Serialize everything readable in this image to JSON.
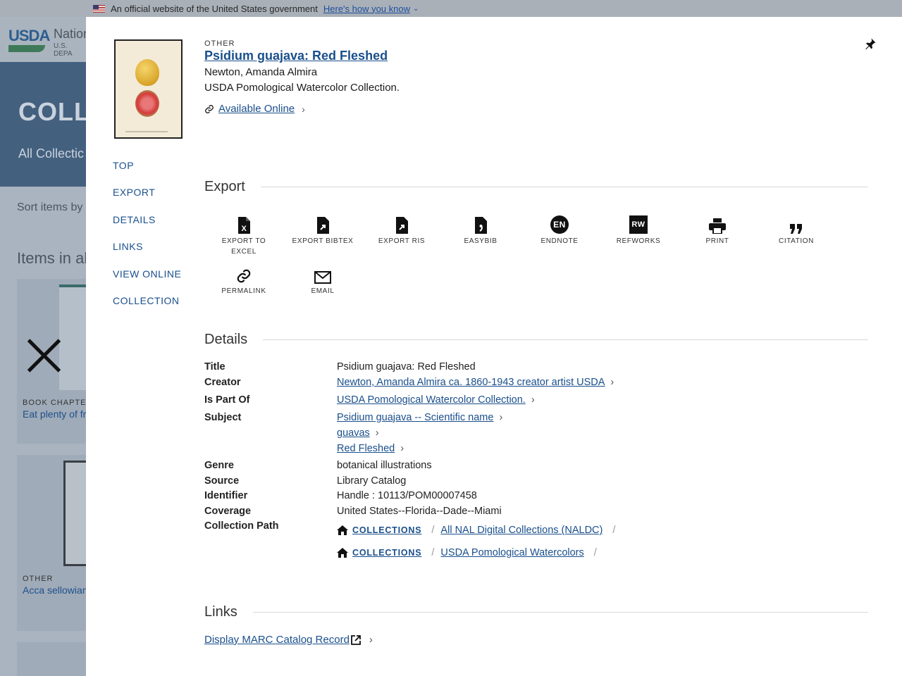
{
  "banner": {
    "text": "An official website of the United States government",
    "link": "Here's how you know"
  },
  "background": {
    "logo": "USDA",
    "agency": "National",
    "department": "U.S. DEPA",
    "hero_title": "COLLE",
    "hero_sub": "All Collectic",
    "sort_label": "Sort items by",
    "items_heading": "Items in al",
    "card1": {
      "kind": "BOOK CHAPTER",
      "title": "Eat plenty of fr"
    },
    "card2": {
      "kind": "OTHER",
      "title": "Acca sellowian"
    }
  },
  "record": {
    "kind": "OTHER",
    "title": "Psidium guajava: Red Fleshed",
    "author": "Newton, Amanda Almira",
    "collection": "USDA Pomological Watercolor Collection.",
    "available": "Available Online"
  },
  "nav": [
    "TOP",
    "EXPORT",
    "DETAILS",
    "LINKS",
    "VIEW ONLINE",
    "COLLECTION"
  ],
  "export": {
    "heading": "Export",
    "items": [
      {
        "label": "EXPORT TO EXCEL",
        "icon": "excel-file-icon"
      },
      {
        "label": "EXPORT BIBTEX",
        "icon": "bibtex-file-icon"
      },
      {
        "label": "EXPORT RIS",
        "icon": "ris-file-icon"
      },
      {
        "label": "EASYBIB",
        "icon": "easybib-icon"
      },
      {
        "label": "ENDNOTE",
        "icon": "endnote-icon",
        "badge": "EN"
      },
      {
        "label": "REFWORKS",
        "icon": "refworks-icon",
        "badge": "RW"
      },
      {
        "label": "PRINT",
        "icon": "printer-icon"
      },
      {
        "label": "CITATION",
        "icon": "quote-icon"
      },
      {
        "label": "PERMALINK",
        "icon": "link-icon"
      },
      {
        "label": "EMAIL",
        "icon": "envelope-icon"
      }
    ]
  },
  "details": {
    "heading": "Details",
    "title_label": "Title",
    "title_value": "Psidium guajava: Red Fleshed",
    "creator_label": "Creator",
    "creator_value": "Newton, Amanda Almira ca. 1860-1943 creator artist USDA",
    "partof_label": "Is Part Of",
    "partof_value": "USDA Pomological Watercolor Collection.",
    "subject_label": "Subject",
    "subjects": [
      "Psidium guajava -- Scientific name",
      "guavas",
      "Red Fleshed"
    ],
    "genre_label": "Genre",
    "genre_value": "botanical illustrations",
    "source_label": "Source",
    "source_value": "Library Catalog",
    "identifier_label": "Identifier",
    "identifier_value": "Handle : 10113/POM00007458",
    "coverage_label": "Coverage",
    "coverage_value": "United States--Florida--Dade--Miami",
    "path_label": "Collection Path",
    "paths": [
      {
        "root": "COLLECTIONS",
        "name": "All NAL Digital Collections (NALDC)"
      },
      {
        "root": "COLLECTIONS",
        "name": "USDA Pomological Watercolors"
      }
    ]
  },
  "links": {
    "heading": "Links",
    "marc": "Display MARC Catalog Record"
  },
  "colors": {
    "link": "#1a4f8c",
    "overlay": "#a9b4c0"
  }
}
